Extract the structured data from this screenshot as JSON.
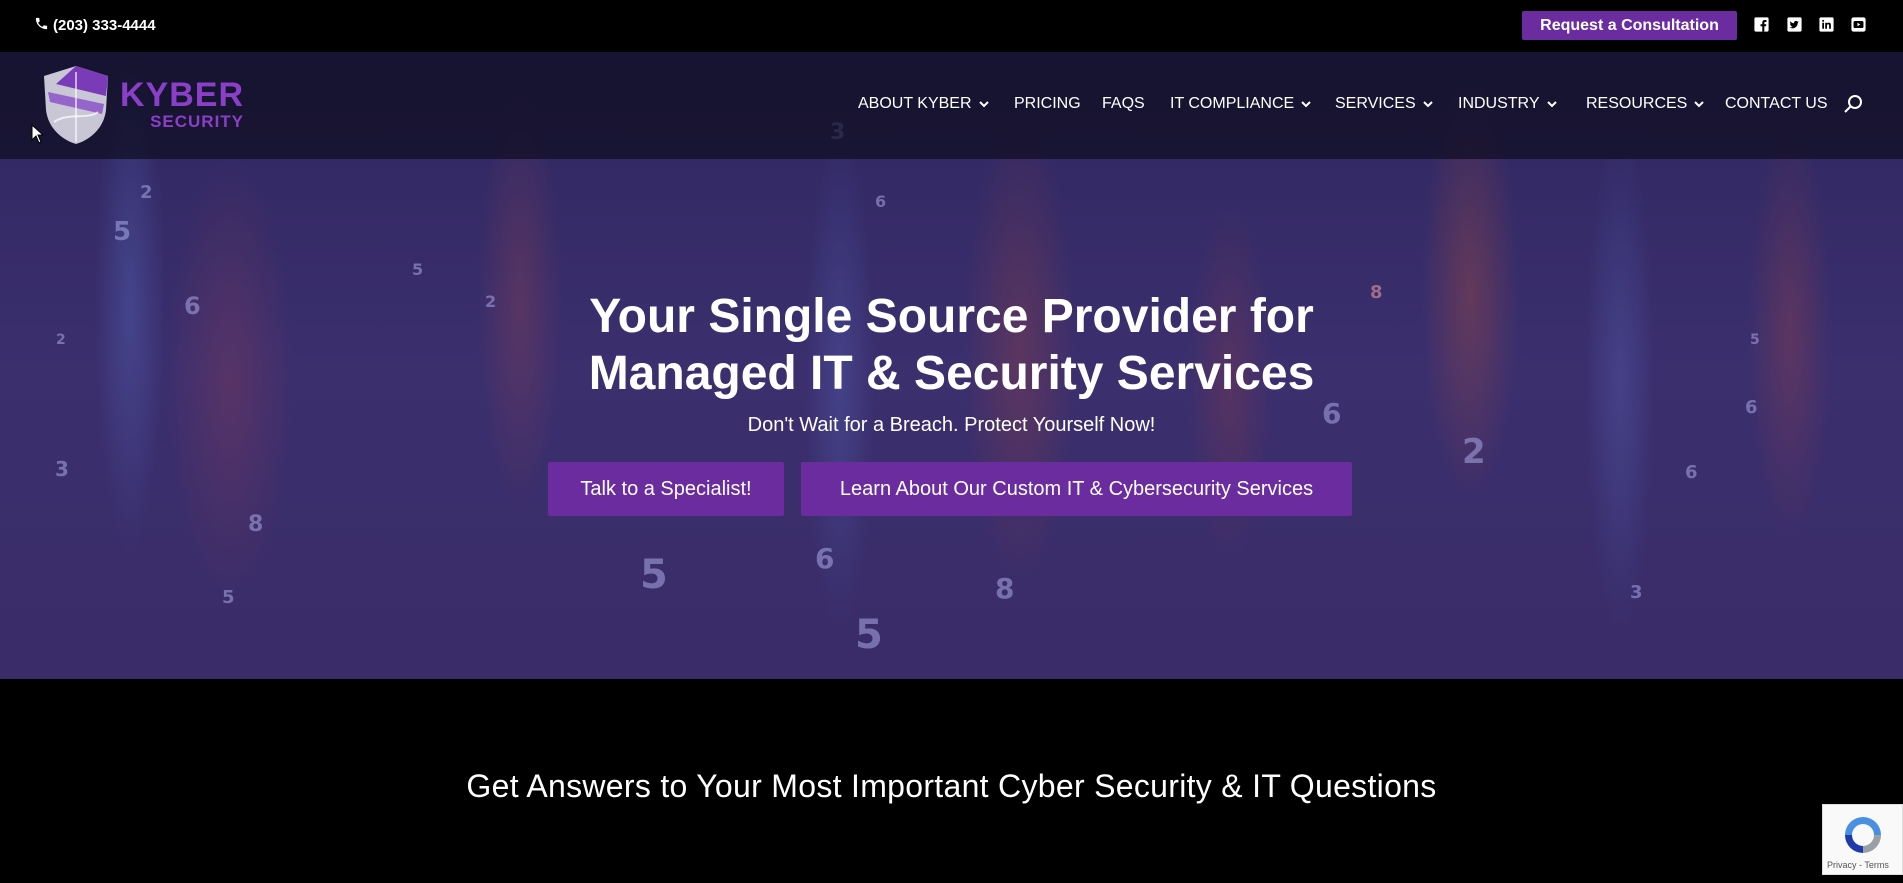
{
  "topbar": {
    "phone": "(203) 333-4444",
    "consult_button": "Request a Consultation",
    "social": [
      "facebook-icon",
      "twitter-icon",
      "linkedin-icon",
      "youtube-icon"
    ]
  },
  "logo": {
    "line1": "KYBER",
    "line2": "SECURITY"
  },
  "nav": {
    "items": [
      {
        "label": "ABOUT KYBER",
        "has_dropdown": true
      },
      {
        "label": "PRICING",
        "has_dropdown": false
      },
      {
        "label": "FAQS",
        "has_dropdown": false
      },
      {
        "label": "IT COMPLIANCE",
        "has_dropdown": true
      },
      {
        "label": "SERVICES",
        "has_dropdown": true
      },
      {
        "label": "INDUSTRY",
        "has_dropdown": true
      },
      {
        "label": "RESOURCES",
        "has_dropdown": true
      },
      {
        "label": "CONTACT US",
        "has_dropdown": false
      }
    ]
  },
  "hero": {
    "title_line1": "Your Single Source Provider for",
    "title_line2": "Managed IT & Security Services",
    "subtitle": "Don't Wait for a Breach. Protect Yourself Now!",
    "button1": "Talk to a Specialist!",
    "button2": "Learn About Our Custom IT & Cybersecurity Services"
  },
  "questions": {
    "title": "Get Answers to Your Most Important Cyber Security & IT Questions"
  },
  "recaptcha": {
    "footer": "Privacy - Terms"
  },
  "colors": {
    "accent": "#6a2c9e",
    "logo": "#8a3fc8",
    "hero_bg": "#352a66",
    "page_bg": "#000000"
  }
}
